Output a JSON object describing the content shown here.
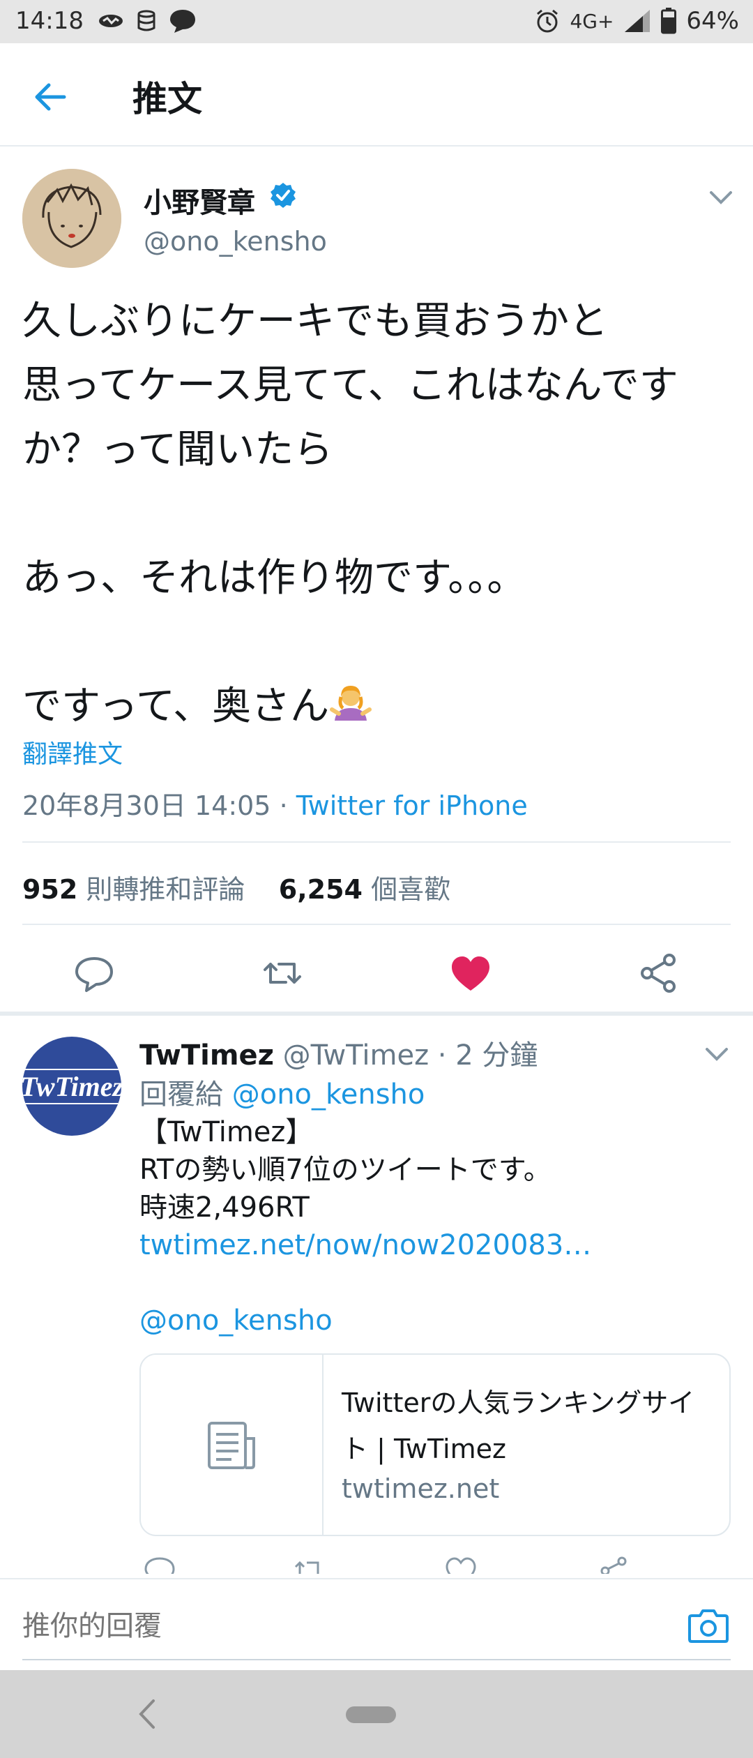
{
  "status_bar": {
    "time": "14:18",
    "network": "4G+",
    "battery": "64%",
    "icons": [
      "eye-notification-icon",
      "database-icon",
      "chat-bubble-icon",
      "alarm-icon",
      "signal-icon",
      "battery-icon"
    ]
  },
  "header": {
    "title": "推文",
    "back_icon": "arrow-left-icon"
  },
  "tweet": {
    "author_name": "小野賢章",
    "author_handle": "@ono_kensho",
    "verified": true,
    "text_lines": [
      "久しぶりにケーキでも買おうかと",
      "思ってケース見てて、これはなんです",
      "か？って聞いたら",
      "",
      "あっ、それは作り物です。。。",
      "",
      "ですって、奥さん"
    ],
    "emoji": "person-shrugging-emoji",
    "translate_label": "翻譯推文",
    "timestamp": "20年8月30日 14:05",
    "separator": " · ",
    "source": "Twitter for iPhone",
    "retweet_count": "952",
    "retweet_label": "則轉推和評論",
    "like_count": "6,254",
    "like_label": "個喜歡",
    "liked": true
  },
  "reply": {
    "author_name": "TwTimez",
    "author_handle": "@TwTimez",
    "time_ago": "· 2 分鐘",
    "reply_to_label": "回覆給",
    "reply_to_handle": "@ono_kensho",
    "avatar_text": "TwTimez",
    "body_lines": [
      "【TwTimez】",
      "RTの勢い順7位のツイートです。",
      "時速2,496RT"
    ],
    "link": "twtimez.net/now/now2020083…",
    "mention": "@ono_kensho",
    "card": {
      "title": "Twitterの人気ランキングサイト | TwTimez",
      "domain": "twtimez.net",
      "icon": "document-icon"
    }
  },
  "composer": {
    "placeholder": "推你的回覆",
    "camera_icon": "camera-icon"
  },
  "colors": {
    "accent": "#1b95e0",
    "like": "#e0245e",
    "secondary_text": "#657786",
    "divider": "#e6ecf0"
  }
}
